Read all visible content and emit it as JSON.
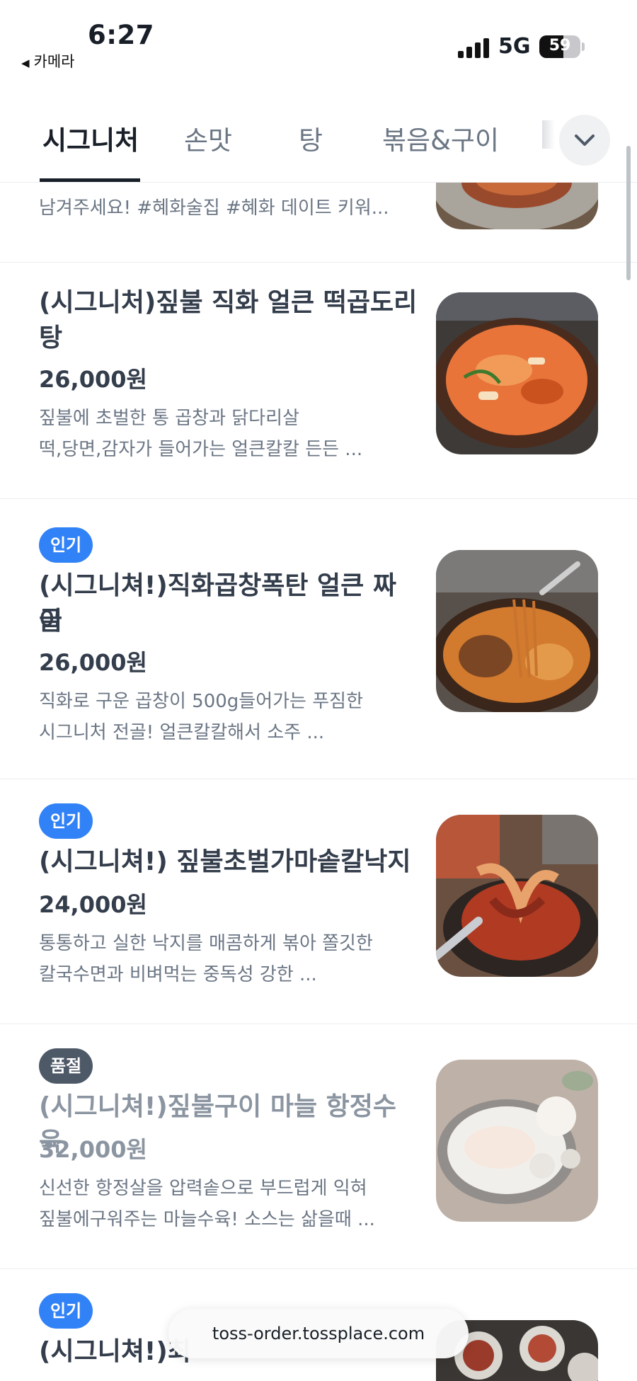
{
  "status_bar": {
    "time": "6:27",
    "back_app": "카메라",
    "network": "5G",
    "battery": "59",
    "battery_level": 0.59
  },
  "tabs": [
    {
      "label": "시그니처",
      "active": true
    },
    {
      "label": "손맛",
      "active": false
    },
    {
      "label": "탕",
      "active": false
    },
    {
      "label": "볶음&구이",
      "active": false
    }
  ],
  "partial_item": {
    "desc": "남겨주세요! #혜화술집 #혜화 데이트 키워..."
  },
  "items": [
    {
      "badge": "",
      "name_line1": "(시그니처)짚불 직화 얼큰 떡곱도리",
      "name_line2": "탕",
      "price": "26,000원",
      "desc_line1": "짚불에 초벌한 통 곱창과 닭다리살",
      "desc_line2": "떡,당면,감자가 들어가는 얼큰칼칼 든든 ..."
    },
    {
      "badge": "인기",
      "name_line1": "(시그니쳐!)직화곱창폭탄 얼큰 짜글",
      "name_line2": "이",
      "price": "26,000원",
      "desc_line1": "직화로 구운 곱창이 500g들어가는 푸짐한",
      "desc_line2": "시그니처 전골! 얼큰칼칼해서 소주 ..."
    },
    {
      "badge": "인기",
      "name_line1": "(시그니쳐!) 짚불초벌가마솥칼낙지",
      "name_line2": "",
      "price": "24,000원",
      "desc_line1": "통통하고 실한 낙지를 매콤하게 볶아 쫄깃한",
      "desc_line2": "칼국수면과 비벼먹는 중독성 강한 ..."
    },
    {
      "badge": "품절",
      "name_line1": "(시그니쳐!)짚불구이 마늘 항정수육",
      "name_line2": "",
      "price": "32,000원",
      "desc_line1": "신선한  항정살을 압력솥으로 부드럽게 익혀",
      "desc_line2": "짚불에구워주는 마늘수육! 소스는 삶을때 ..."
    },
    {
      "badge": "인기",
      "name_line1": "(시그니쳐!)최",
      "name_line2": ""
    }
  ],
  "url_bar": {
    "url": "toss-order.tossplace.com"
  },
  "colors": {
    "accent_blue": "#3182f6",
    "sold_out_gray": "#4e5968",
    "text_primary": "#191f28",
    "text_secondary": "#6b7684"
  },
  "icons": {
    "tab_toggle": "chevron-down-icon",
    "back": "back-triangle-icon"
  }
}
